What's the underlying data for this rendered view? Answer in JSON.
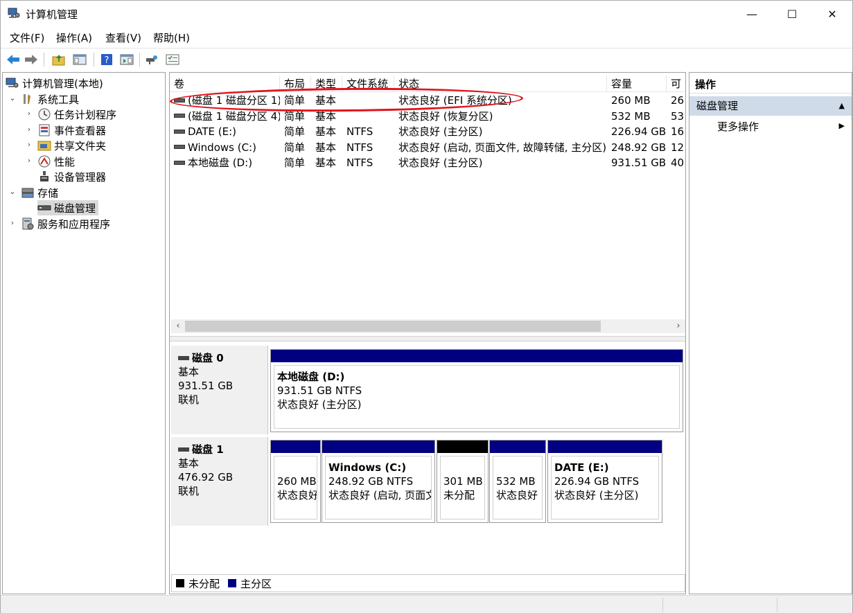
{
  "window": {
    "title": "计算机管理"
  },
  "window_controls": {
    "minimize": "—",
    "maximize": "☐",
    "close": "✕"
  },
  "menu": [
    "文件(F)",
    "操作(A)",
    "查看(V)",
    "帮助(H)"
  ],
  "tree": {
    "root": "计算机管理(本地)",
    "items": [
      {
        "label": "系统工具",
        "arrow": "⌄"
      },
      {
        "label": "任务计划程序",
        "arrow": "›"
      },
      {
        "label": "事件查看器",
        "arrow": "›"
      },
      {
        "label": "共享文件夹",
        "arrow": "›"
      },
      {
        "label": "性能",
        "arrow": "›"
      },
      {
        "label": "设备管理器",
        "arrow": ""
      },
      {
        "label": "存储",
        "arrow": "⌄"
      },
      {
        "label": "磁盘管理",
        "arrow": ""
      },
      {
        "label": "服务和应用程序",
        "arrow": "›"
      }
    ]
  },
  "volume_list": {
    "columns": [
      "卷",
      "布局",
      "类型",
      "文件系统",
      "状态",
      "容量",
      "可"
    ],
    "rows": [
      [
        "(磁盘 1 磁盘分区 1)",
        "简单",
        "基本",
        "",
        "状态良好 (EFI 系统分区)",
        "260 MB",
        "26"
      ],
      [
        "(磁盘 1 磁盘分区 4)",
        "简单",
        "基本",
        "",
        "状态良好 (恢复分区)",
        "532 MB",
        "53"
      ],
      [
        "DATE (E:)",
        "简单",
        "基本",
        "NTFS",
        "状态良好 (主分区)",
        "226.94 GB",
        "16"
      ],
      [
        "Windows (C:)",
        "简单",
        "基本",
        "NTFS",
        "状态良好 (启动, 页面文件, 故障转储, 主分区)",
        "248.92 GB",
        "12"
      ],
      [
        "本地磁盘 (D:)",
        "简单",
        "基本",
        "NTFS",
        "状态良好 (主分区)",
        "931.51 GB",
        "40"
      ]
    ],
    "scroll_left": "‹",
    "scroll_right": "›"
  },
  "disks": [
    {
      "name": "磁盘 0",
      "type": "基本",
      "size": "931.51 GB",
      "status": "联机",
      "partitions": [
        {
          "name": "本地磁盘 (D:)",
          "line1": "931.51 GB NTFS",
          "line2": "状态良好 (主分区)",
          "kind": "primary"
        }
      ]
    },
    {
      "name": "磁盘 1",
      "type": "基本",
      "size": "476.92 GB",
      "status": "联机",
      "partitions": [
        {
          "name": "",
          "line1": "260 MB",
          "line2": "状态良好",
          "kind": "primary"
        },
        {
          "name": "Windows  (C:)",
          "line1": "248.92 GB NTFS",
          "line2": "状态良好 (启动, 页面文",
          "kind": "primary"
        },
        {
          "name": "",
          "line1": "301 MB",
          "line2": "未分配",
          "kind": "unallocated"
        },
        {
          "name": "",
          "line1": "532 MB",
          "line2": "状态良好",
          "kind": "primary"
        },
        {
          "name": "DATE  (E:)",
          "line1": "226.94 GB NTFS",
          "line2": "状态良好 (主分区)",
          "kind": "primary"
        }
      ]
    }
  ],
  "legend": {
    "unallocated": "未分配",
    "primary": "主分区"
  },
  "actions": {
    "title": "操作",
    "section": "磁盘管理",
    "more": "更多操作",
    "collapse_glyph": "▲",
    "more_glyph": "▶"
  },
  "colors": {
    "primary": "#000080",
    "unallocated": "#000000",
    "annotation": "#e0141c",
    "selected_section": "#cfdbe8"
  }
}
